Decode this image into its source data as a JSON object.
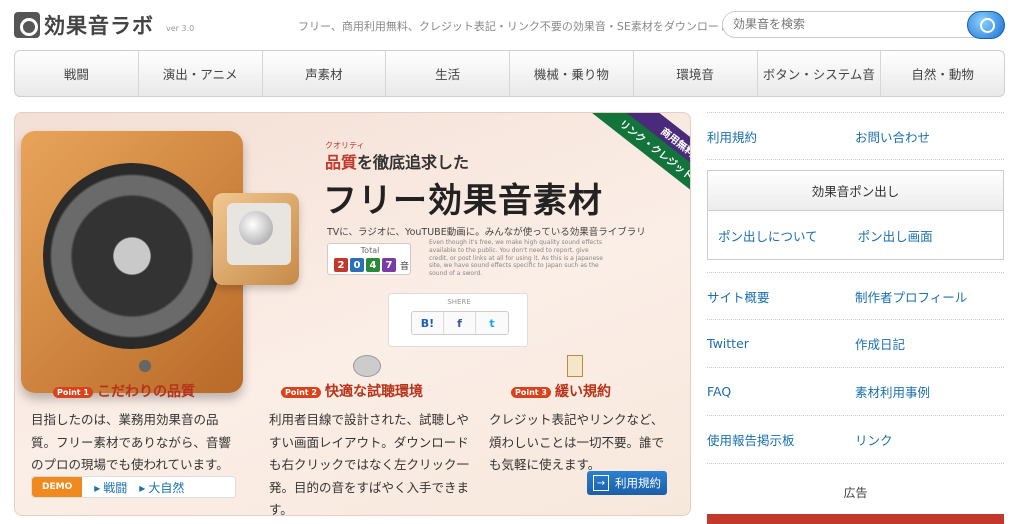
{
  "header": {
    "logo_text": "効果音ラボ",
    "version": "ver 3.0",
    "tagline": "フリー、商用利用無料、クレジット表記・リンク不要の効果音・SE素材をダウンロード",
    "search_placeholder": "効果音を検索"
  },
  "nav": {
    "items": [
      "戦闘",
      "演出・アニメ",
      "声素材",
      "生活",
      "機械・乗り物",
      "環境音",
      "ボタン・システム音",
      "自然・動物"
    ]
  },
  "hero": {
    "ribbon_green": "リンク・クレジット表記不要",
    "ribbon_purple": "商用無料",
    "quality_ruby": "クオリティ",
    "quality_word": "品質",
    "quality_rest": "を徹底追求した",
    "headline": "フリー効果音素材",
    "sub": "TVに、ラジオに、YouTUBE動画に。みんなが使っている効果音ライブラリ",
    "total_label": "Total",
    "total_digits": [
      "2",
      "0",
      "4",
      "7"
    ],
    "total_unit": "音",
    "english_text": "Even though it's free, we make high quality sound effects available to the public. You don't need to report, give credit, or post links at all for using it. As this is a Japanese site, we have sound effects specific to Japan such as the sound of a sword.",
    "share_label": "SHERE",
    "share_buttons": [
      "B!",
      "f",
      "t"
    ],
    "features": [
      {
        "point": "Point 1",
        "title": "こだわりの品質",
        "body": "目指したのは、業務用効果音の品質。フリー素材でありながら、音響のプロの現場でも使われています。"
      },
      {
        "point": "Point 2",
        "title": "快適な試聴環境",
        "body": "利用者目線で設計された、試聴しやすい画面レイアウト。ダウンロードも右クリックではなく左クリック一発。目的の音をすばやく入手できます。"
      },
      {
        "point": "Point 3",
        "title": "緩い規約",
        "body": "クレジット表記やリンクなど、煩わしいことは一切不要。誰でも気軽に使えます。"
      }
    ],
    "demo_badge": "DEMO",
    "demo_links": [
      "戦闘",
      "大自然"
    ],
    "terms_button": "利用規約"
  },
  "sidebar": {
    "row1": [
      "利用規約",
      "お問い合わせ"
    ],
    "pon_title": "効果音ポン出し",
    "pon_links": [
      "ポン出しについて",
      "ポン出し画面"
    ],
    "rows": [
      [
        "サイト概要",
        "制作者プロフィール"
      ],
      [
        "Twitter",
        "作成日記"
      ],
      [
        "FAQ",
        "素材利用事例"
      ],
      [
        "使用報告掲示板",
        "リンク"
      ]
    ],
    "ad_label": "広告"
  },
  "colors": {
    "link": "#1a6fb0",
    "accent_red": "#b8321a",
    "digits": [
      "#c0392b",
      "#2a6fb8",
      "#2a8a3a",
      "#7a3aa8"
    ]
  }
}
